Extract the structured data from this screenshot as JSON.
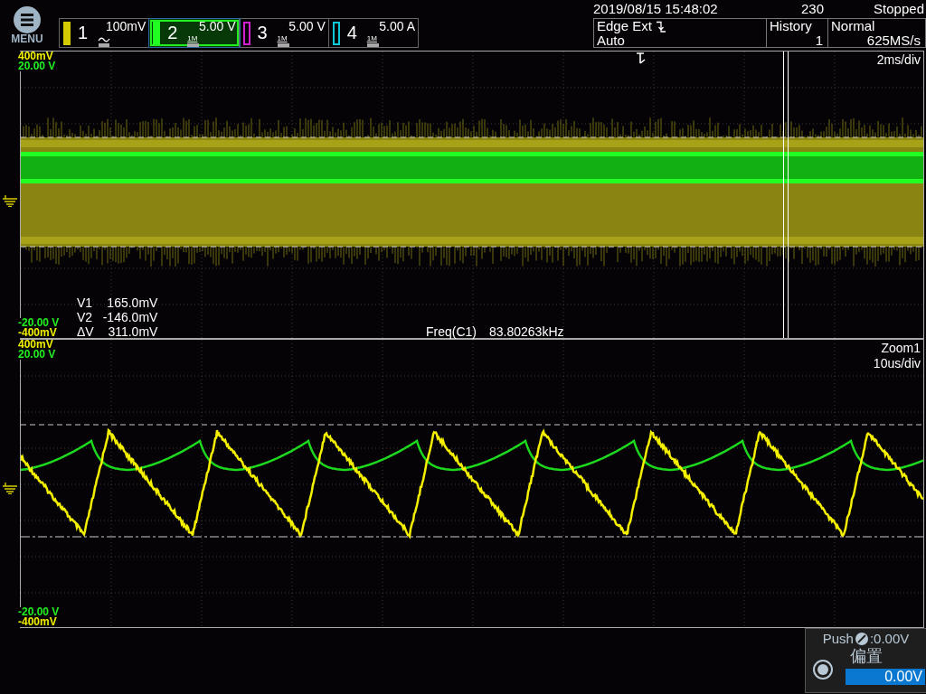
{
  "menu": {
    "label": "MENU"
  },
  "channels": [
    {
      "number": "1",
      "scale": "100mV",
      "kind": "ac",
      "color": "#d4cc00",
      "selected": false
    },
    {
      "number": "2",
      "scale": "5.00 V",
      "kind": "dc",
      "impedance": "1M",
      "color": "#22ff22",
      "selected": true
    },
    {
      "number": "3",
      "scale": "5.00 V",
      "kind": "dc",
      "impedance": "1M",
      "color": "#d020d0",
      "selected": false
    },
    {
      "number": "4",
      "scale": "5.00 A",
      "kind": "dc",
      "impedance": "1M",
      "color": "#10c8d8",
      "selected": false
    }
  ],
  "status": {
    "datetime": "2019/08/15 15:48:02",
    "count": "230",
    "state": "Stopped"
  },
  "trigger": {
    "type": "Edge Ext",
    "mode": "Auto"
  },
  "history": {
    "label": "History",
    "value": "1"
  },
  "acquisition": {
    "mode": "Normal",
    "rate": "625MS/s"
  },
  "views": [
    {
      "kind": "overview",
      "timebase": "2ms/div",
      "scale_top": [
        {
          "text": "400mV",
          "color": "#f0f000"
        },
        {
          "text": "20.00 V",
          "color": "#22ee22"
        }
      ],
      "scale_bottom": [
        {
          "text": "-20.00 V",
          "color": "#22ee22"
        },
        {
          "text": "-400mV",
          "color": "#f0f000"
        }
      ],
      "cursor_readings": [
        {
          "label": "V1",
          "value": "165.0mV"
        },
        {
          "label": "V2",
          "value": "-146.0mV"
        },
        {
          "label": "ΔV",
          "value": "311.0mV"
        }
      ],
      "measurement": {
        "label": "Freq(C1)",
        "value": "83.80263kHz"
      }
    },
    {
      "kind": "zoom",
      "title": "Zoom1",
      "timebase": "10us/div",
      "scale_top": [
        {
          "text": "400mV",
          "color": "#f0f000"
        },
        {
          "text": "20.00 V",
          "color": "#22ee22"
        }
      ],
      "scale_bottom": [
        {
          "text": "-20.00 V",
          "color": "#22ee22"
        },
        {
          "text": "-400mV",
          "color": "#f0f000"
        }
      ]
    }
  ],
  "knob_panel": {
    "hint": "Push",
    "hint_value": ":0.00V",
    "title": "偏置",
    "value": "0.00V"
  }
}
